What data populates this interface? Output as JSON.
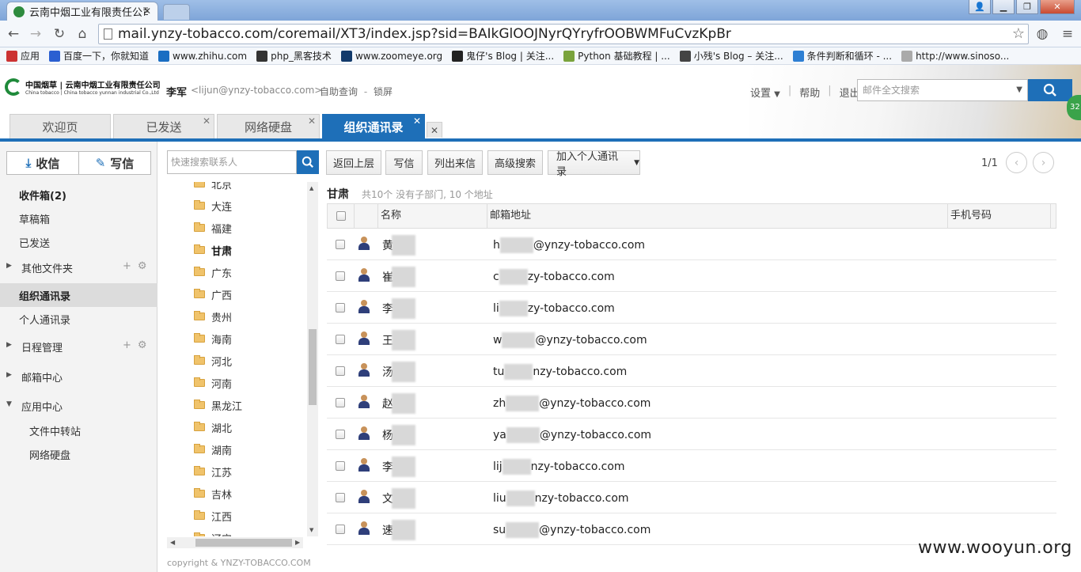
{
  "browser": {
    "tab_title": "云南中烟工业有限责任公司",
    "url": "mail.ynzy-tobacco.com/coremail/XT3/index.jsp?sid=BAIkGlOOJNyrQYryfrOOBWMFuCvzKpBr",
    "bookmarks": [
      {
        "label": "应用",
        "color": "#cc3333"
      },
      {
        "label": "百度一下，你就知道",
        "color": "#2b5fd1"
      },
      {
        "label": "www.zhihu.com",
        "color": "#1a6ec2"
      },
      {
        "label": "php_黑客技术",
        "color": "#333333"
      },
      {
        "label": "www.zoomeye.org",
        "color": "#123a6b"
      },
      {
        "label": "鬼仔's Blog | 关注...",
        "color": "#222222"
      },
      {
        "label": "Python 基础教程 | ...",
        "color": "#7aa33c"
      },
      {
        "label": "小残's Blog – 关注...",
        "color": "#444444"
      },
      {
        "label": "条件判断和循环 - ...",
        "color": "#2e7fd3"
      },
      {
        "label": "http://www.sinoso...",
        "color": "#aaaaaa"
      }
    ]
  },
  "header": {
    "logo_line1": "中国烟草 | 云南中烟工业有限责任公司",
    "logo_line2": "China tobacco | China tobacco yunnan industrial Co.,Ltd",
    "user_name": "李军",
    "user_email": "<lijun@ynzy-tobacco.com>",
    "self_query": "自助查询",
    "lock": "锁屏",
    "settings": "设置",
    "help": "帮助",
    "logout": "退出",
    "search_placeholder": "邮件全文搜索",
    "badge": "32"
  },
  "apptabs": [
    "欢迎页",
    "已发送",
    "网络硬盘",
    "组织通讯录"
  ],
  "sidebar": {
    "receive": "收信",
    "compose": "写信",
    "items": [
      "收件箱(2)",
      "草稿箱",
      "已发送",
      "其他文件夹",
      "组织通讯录",
      "个人通讯录",
      "日程管理",
      "邮箱中心",
      "应用中心",
      "文件中转站",
      "网络硬盘"
    ]
  },
  "tree": {
    "search_placeholder": "快速搜索联系人",
    "items": [
      "北京",
      "大连",
      "福建",
      "甘肃",
      "广东",
      "广西",
      "贵州",
      "海南",
      "河北",
      "河南",
      "黑龙江",
      "湖北",
      "湖南",
      "江苏",
      "吉林",
      "江西",
      "辽宁"
    ]
  },
  "toolbar": {
    "back": "返回上层",
    "write": "写信",
    "list_mail": "列出来信",
    "advanced": "高级搜索",
    "add_personal": "加入个人通讯录",
    "pager": "1/1"
  },
  "group": {
    "name": "甘肃",
    "info": "共10个 没有子部门, 10 个地址"
  },
  "table": {
    "columns": [
      "名称",
      "邮箱地址",
      "手机号码"
    ],
    "rows": [
      {
        "name": "黄",
        "email_prefix": "h",
        "email_suffix": "@ynzy-tobacco.com"
      },
      {
        "name": "崔",
        "email_prefix": "c",
        "email_suffix": "zy-tobacco.com"
      },
      {
        "name": "李",
        "email_prefix": "li",
        "email_suffix": "zy-tobacco.com"
      },
      {
        "name": "王",
        "email_prefix": "w",
        "email_suffix": "@ynzy-tobacco.com"
      },
      {
        "name": "汤",
        "email_prefix": "tu",
        "email_suffix": "nzy-tobacco.com"
      },
      {
        "name": "赵",
        "email_prefix": "zh",
        "email_suffix": "@ynzy-tobacco.com"
      },
      {
        "name": "杨",
        "email_prefix": "ya",
        "email_suffix": "@ynzy-tobacco.com"
      },
      {
        "name": "李",
        "email_prefix": "lij",
        "email_suffix": "nzy-tobacco.com"
      },
      {
        "name": "文",
        "email_prefix": "liu",
        "email_suffix": "nzy-tobacco.com"
      },
      {
        "name": "速",
        "email_prefix": "su",
        "email_suffix": "@ynzy-tobacco.com"
      }
    ]
  },
  "footer": {
    "copyright": "copyright & YNZY-TOBACCO.COM",
    "watermark": "www.wooyun.org"
  }
}
